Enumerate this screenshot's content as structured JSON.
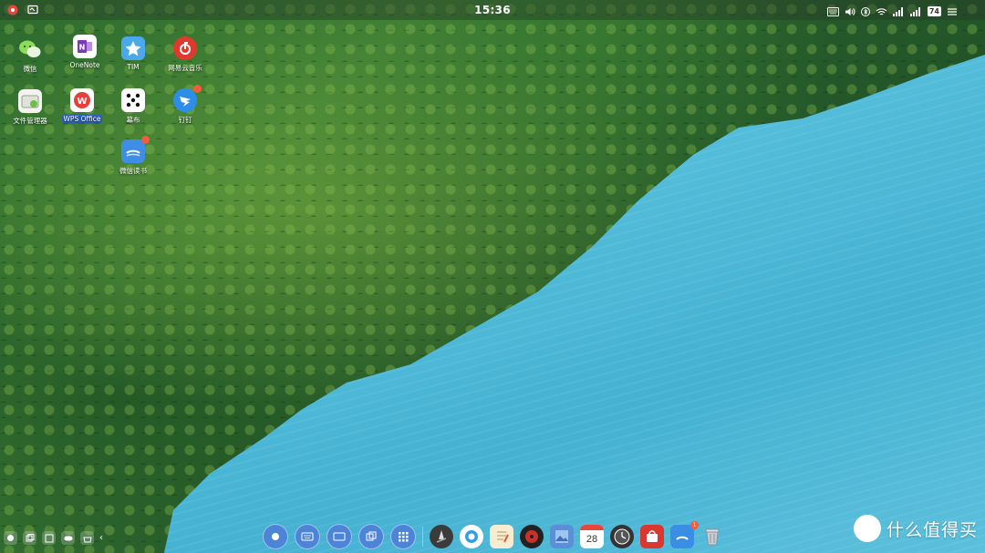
{
  "topbar": {
    "clock": "15:36",
    "battery_level": "74"
  },
  "desktop": {
    "icons": [
      {
        "label": "微信",
        "icon": "wechat-icon"
      },
      {
        "label": "OneNote",
        "icon": "onenote-icon"
      },
      {
        "label": "TIM",
        "icon": "tim-icon"
      },
      {
        "label": "网易云音乐",
        "icon": "netease-music-icon"
      },
      {
        "label": "文件管理器",
        "icon": "file-manager-icon"
      },
      {
        "label": "WPS Office",
        "icon": "wps-office-icon"
      },
      {
        "label": "幕布",
        "icon": "mubu-icon"
      },
      {
        "label": "钉钉",
        "icon": "dingtalk-icon"
      },
      {
        "label": "微信读书",
        "icon": "wechat-read-icon"
      }
    ]
  },
  "dock": {
    "calendar_day": "28",
    "notification_count": "1"
  },
  "watermark": {
    "logo_char": "值",
    "text": "什么值得买"
  },
  "colors": {
    "accent": "#4c85d8",
    "selected_label": "#2c62b8",
    "badge": "#f25c3a"
  }
}
